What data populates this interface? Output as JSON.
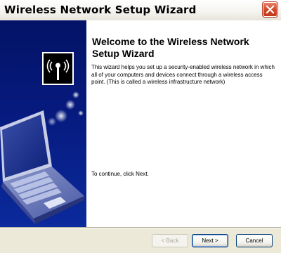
{
  "window": {
    "title": "Wireless Network Setup Wizard"
  },
  "content": {
    "heading": "Welcome to the Wireless Network Setup Wizard",
    "intro": "This wizard helps you set up a security-enabled wireless network in which all of your computers and devices connect through a wireless access point. (This is called a wireless infrastructure network)",
    "continue_text": "To continue, click Next."
  },
  "buttons": {
    "back": "< Back",
    "next": "Next >",
    "cancel": "Cancel"
  },
  "icons": {
    "close": "close-icon",
    "wireless": "wireless-antenna-icon",
    "laptop": "laptop-illustration"
  },
  "colors": {
    "left_panel": "#06197c",
    "close_button": "#d4472a"
  }
}
